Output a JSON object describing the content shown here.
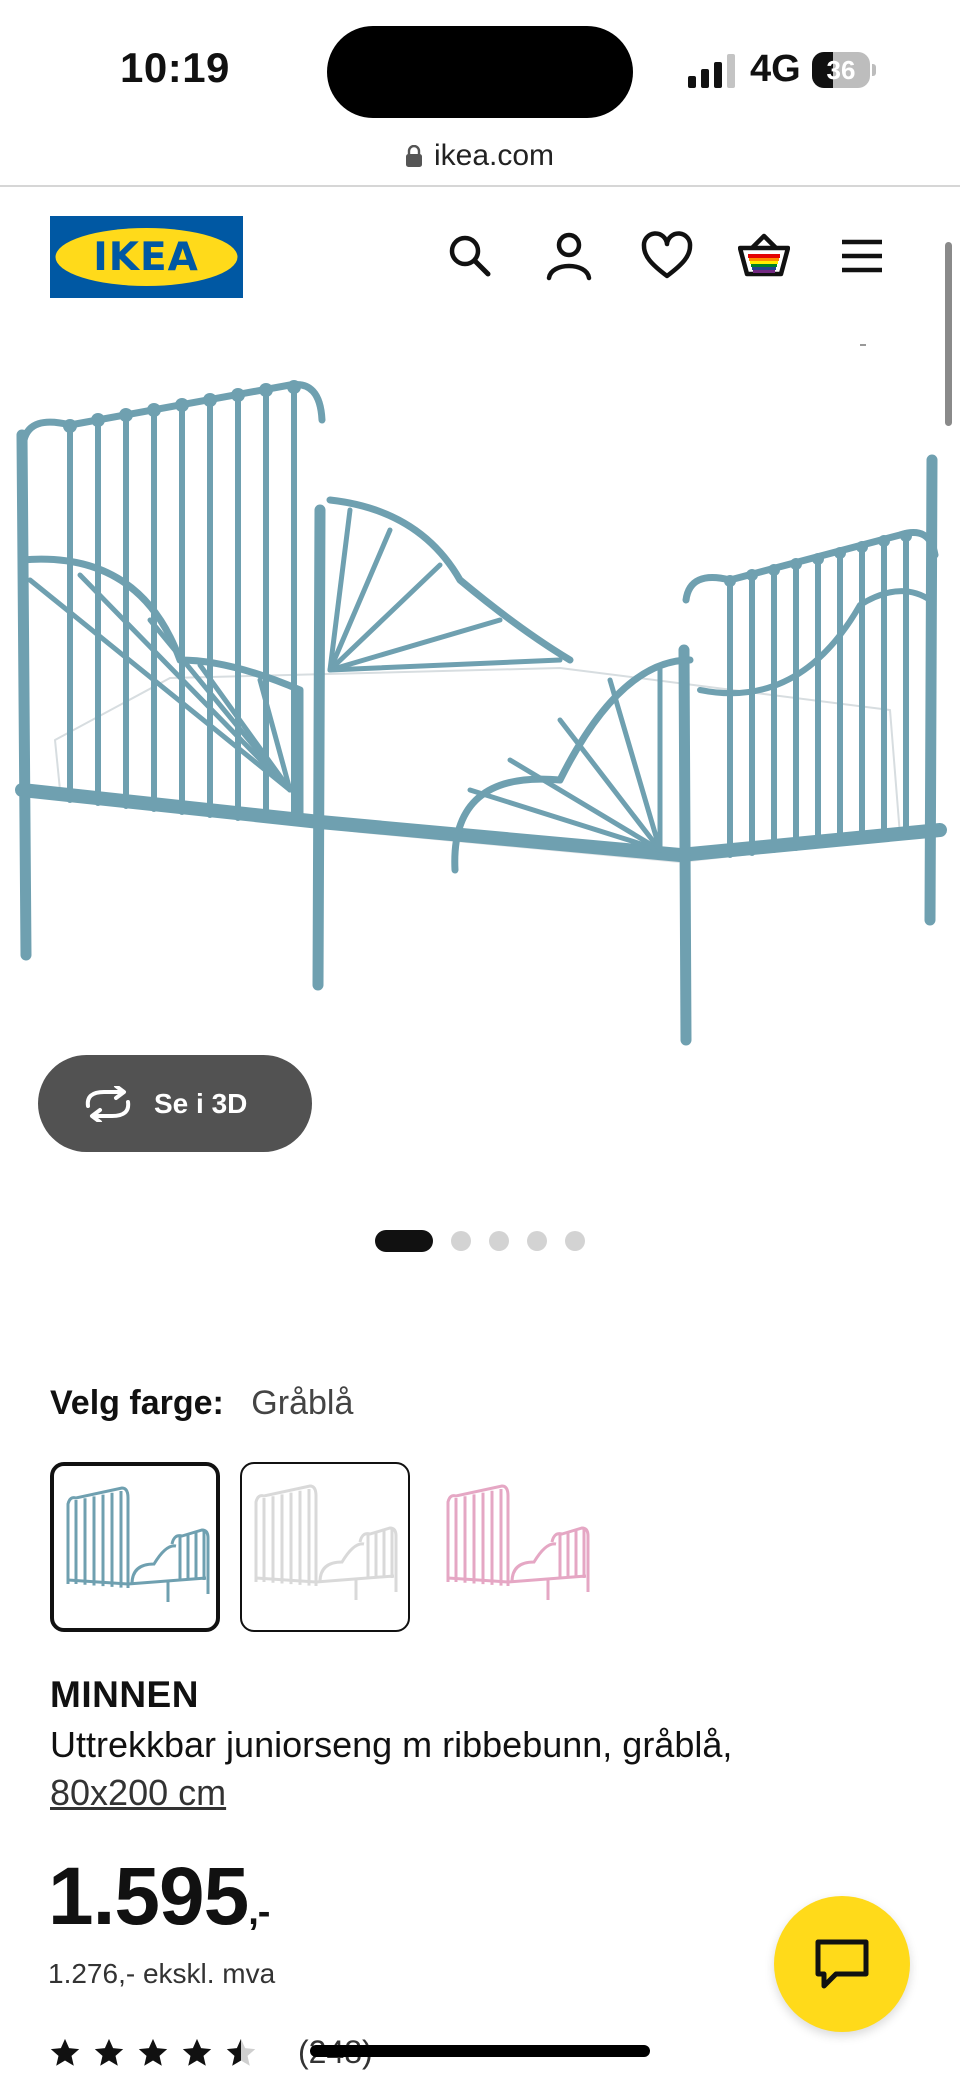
{
  "status_bar": {
    "time": "10:19",
    "network": "4G",
    "battery": "36"
  },
  "browser": {
    "url": "ikea.com"
  },
  "header": {
    "logo_text": "IKEA",
    "brand_blue": "#0058A3",
    "brand_yellow": "#FFDA1A"
  },
  "gallery": {
    "view_3d_label": "Se i 3D",
    "slide_count": 5,
    "active_slide": 1
  },
  "color_selector": {
    "label": "Velg farge:",
    "selected": "Gråblå",
    "options": [
      {
        "color": "#6FA0B0"
      },
      {
        "color": "#E3E3E3"
      },
      {
        "color": "#E5A7C4"
      }
    ]
  },
  "product": {
    "name": "MINNEN",
    "description": "Uttrekkbar juniorseng m ribbebunn, gråblå,",
    "size": "80x200 cm",
    "price": "1.595",
    "price_suffix": ",-",
    "price_ex_vat": "1.276,- ekskl. mva",
    "rating": 4.5,
    "review_count": "(248)"
  }
}
